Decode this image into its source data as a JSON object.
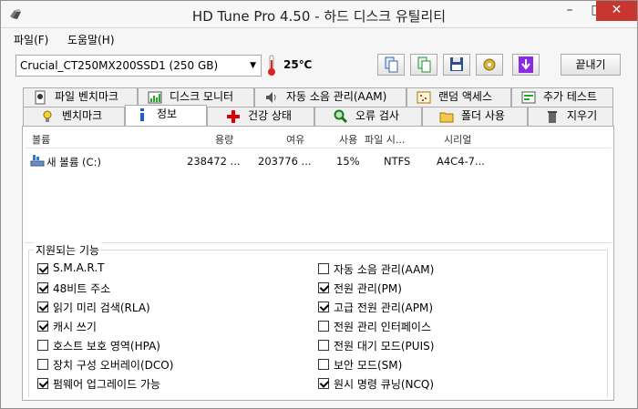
{
  "window": {
    "title": "HD Tune Pro 4.50 - 하드 디스크 유틸리티"
  },
  "menu": {
    "file": "파일(F)",
    "help": "도움말(H)"
  },
  "toolbar": {
    "drive": "Crucial_CT250MX200SSD1 (250 GB)",
    "temperature": "25℃",
    "exit_label": "끝내기"
  },
  "tabs_top": [
    {
      "label": "파일 벤치마크",
      "icon": "file-benchmark-icon"
    },
    {
      "label": "디스크 모니터",
      "icon": "disk-monitor-icon"
    },
    {
      "label": "자동 소음 관리(AAM)",
      "icon": "speaker-icon"
    },
    {
      "label": "랜덤 액세스",
      "icon": "random-access-icon"
    },
    {
      "label": "추가 테스트",
      "icon": "extra-tests-icon"
    }
  ],
  "tabs_bottom": [
    {
      "label": "벤치마크",
      "icon": "benchmark-icon"
    },
    {
      "label": "정보",
      "icon": "info-icon"
    },
    {
      "label": "건강 상태",
      "icon": "health-cross-icon"
    },
    {
      "label": "오류 검사",
      "icon": "magnifier-icon"
    },
    {
      "label": "폴더 사용",
      "icon": "folder-icon"
    },
    {
      "label": "지우기",
      "icon": "trash-icon"
    }
  ],
  "volumes": {
    "headers": [
      "볼륨",
      "용량",
      "여유",
      "사용",
      "파일 시...",
      "시리얼"
    ],
    "rows": [
      {
        "name": "새 볼륨 (C:)",
        "capacity": "238472 ...",
        "free": "203776 ...",
        "used": "15%",
        "fs": "NTFS",
        "serial": "A4C4-7..."
      }
    ]
  },
  "features": {
    "title": "지원되는 기능",
    "left": [
      {
        "label": "S.M.A.R.T",
        "checked": true
      },
      {
        "label": "48비트 주소",
        "checked": true
      },
      {
        "label": "읽기 미리 검색(RLA)",
        "checked": true
      },
      {
        "label": "캐시 쓰기",
        "checked": true
      },
      {
        "label": "호스트 보호 영역(HPA)",
        "checked": false
      },
      {
        "label": "장치 구성 오버레이(DCO)",
        "checked": false
      },
      {
        "label": "펌웨어 업그레이드 가능",
        "checked": true
      }
    ],
    "right": [
      {
        "label": "자동 소음 관리(AAM)",
        "checked": false
      },
      {
        "label": "전원 관리(PM)",
        "checked": true
      },
      {
        "label": "고급 전원 관리(APM)",
        "checked": true
      },
      {
        "label": "전원 관리 인터페이스",
        "checked": false
      },
      {
        "label": "전원 대기 모드(PUIS)",
        "checked": false
      },
      {
        "label": "보안 모드(SM)",
        "checked": false
      },
      {
        "label": "원시 명령 큐닝(NCQ)",
        "checked": true
      }
    ]
  }
}
